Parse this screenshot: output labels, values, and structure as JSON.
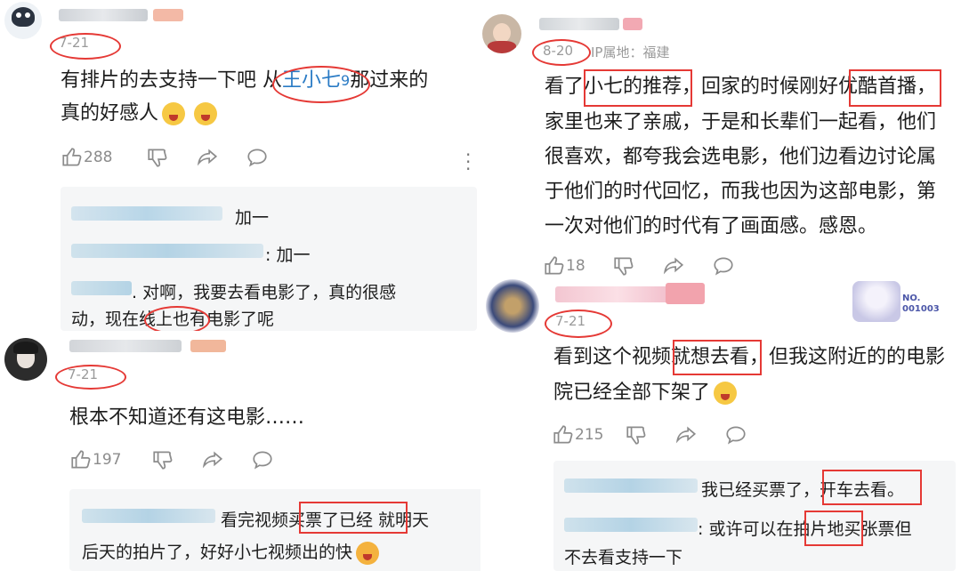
{
  "comments": [
    {
      "id": "c1",
      "date": "7-21",
      "text_before": "有排片的去支持一下吧 从",
      "mention": "王小七",
      "text_after": "那过来的",
      "line2": "真的好感人",
      "likes": "288",
      "replies": [
        {
          "text": "加一"
        },
        {
          "text": ": 加一"
        },
        {
          "text_a": ". 对啊，我要去看电影了，真的很感",
          "text_b": "动，现在线上也有电影了呢"
        }
      ]
    },
    {
      "id": "c2",
      "date": "7-21",
      "text": "根本不知道还有这电影……",
      "likes": "197",
      "replies": [
        {
          "text_a": "看完视频买票了已经  就明天",
          "text_b": "后天的拍片了，好好小七视频出的快"
        }
      ]
    },
    {
      "id": "c3",
      "date": "8-20",
      "ip": "IP属地：福建",
      "lines": [
        "看了小七的推荐，回家的时候刚好优酷首播，",
        "家里也来了亲戚，于是和长辈们一起看，他们",
        "很喜欢，都夸我会选电影，他们边看边讨论属",
        "于他们的时代回忆，而我也因为这部电影，第",
        "一次对他们的时代有了画面感。感恩。"
      ],
      "likes": "18"
    },
    {
      "id": "c4",
      "date": "7-21",
      "badge": "NO. 001003",
      "lines": [
        "看到这个视频就想去看，但我这附近的的电影",
        "院已经全部下架了"
      ],
      "likes": "215",
      "replies": [
        {
          "text": "我已经买票了，开车去看。"
        },
        {
          "text_a": ": 或许可以在拍片地买张票但",
          "text_b": "不去看支持一下"
        }
      ]
    }
  ],
  "icons": [
    "like-icon",
    "dislike-icon",
    "share-icon",
    "comment-icon",
    "more-icon"
  ],
  "colors": {
    "accent": "#e53935",
    "mention": "#2a7bc5",
    "muted": "#8c8c8c",
    "reply_bg": "#f5f6f7"
  }
}
